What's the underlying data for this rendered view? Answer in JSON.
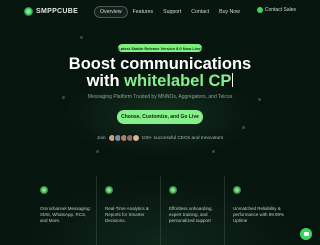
{
  "header": {
    "logo_text": "SMPPCUBE",
    "nav": [
      {
        "label": "Overview",
        "active": true
      },
      {
        "label": "Features",
        "active": false
      },
      {
        "label": "Support",
        "active": false
      },
      {
        "label": "Contact",
        "active": false
      },
      {
        "label": "Buy Now",
        "active": false
      }
    ],
    "contact_sales": "Contact Sales"
  },
  "hero": {
    "badge": "Latest Stable Release Version 8.0 Now Live!",
    "headline_line1": "Boost communications",
    "headline_line2_plain": "with",
    "headline_line2_accent": "whitelabel CP",
    "subtitle": "Messaging Platform Trusted by MNNOs, Aggregators, and Telcos",
    "cta_label": "Choose, Customize, and Go Live",
    "join_prefix": "Join",
    "join_suffix": "100+ successful CEOs and Innovators"
  },
  "features": [
    {
      "text": "Omnichannel Messaging: SMS, WhatsApp, RCS, and More.",
      "icon": "chat-icon"
    },
    {
      "text": "Real-Time Analytics & Reports for Smarter Decisions.",
      "icon": "chart-icon"
    },
    {
      "text": "Effortless onboarding, expert training, and personalized support",
      "icon": "support-icon"
    },
    {
      "text": "Unmatched Reliability & performance with 99.99% Uptime",
      "icon": "shield-icon"
    }
  ],
  "colors": {
    "background": "#07150f",
    "accent": "#86f08b"
  }
}
